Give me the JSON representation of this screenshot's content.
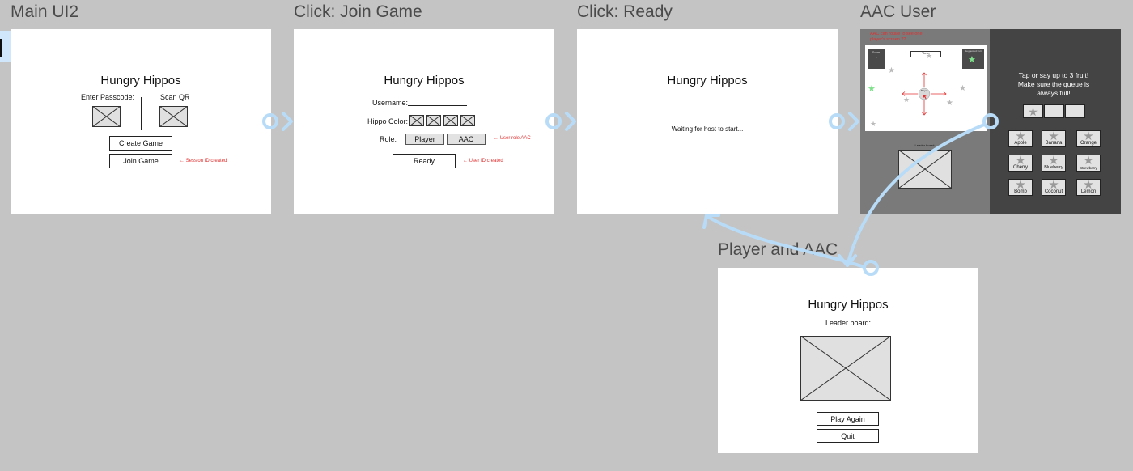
{
  "frames": {
    "main": {
      "frame_title": "Main UI2",
      "app_title": "Hungry Hippos",
      "passcode_label": "Enter Passcode:",
      "qr_label": "Scan QR",
      "create_label": "Create Game",
      "join_label": "Join Game",
      "note": "← Session ID created"
    },
    "join": {
      "frame_title": "Click: Join Game",
      "app_title": "Hungry Hippos",
      "username_label": "Username:",
      "color_label": "Hippo Color:",
      "role_label": "Role:",
      "player_label": "Player",
      "aac_label": "AAC",
      "role_note": "← User role AAC",
      "ready_label": "Ready",
      "ready_note": "← User ID created"
    },
    "ready": {
      "frame_title": "Click: Ready",
      "app_title": "Hungry Hippos",
      "status": "Waiting for host to start..."
    },
    "aac": {
      "frame_title": "AAC User",
      "rotate_note": "AAC can rotate to see one player's screen ??",
      "score_label": "Score",
      "score_value": "7",
      "timer_label": "Timer",
      "suggested_label": "Suggested fruit",
      "player_label": "Player",
      "leaderboard_label": "Leader board:",
      "instructions": "Tap or say up to 3 fruit! Make sure the queue is always full!",
      "fruits": [
        "Apple",
        "Banana",
        "Orange",
        "Cherry",
        "Blueberry",
        "Strewberry",
        "Bomb",
        "Coconut",
        "Lemon"
      ],
      "colors": {
        "panel_dark": "#444444",
        "panel_mid": "#777777",
        "green_star": "#7ee08a"
      }
    },
    "end": {
      "frame_title": "Player and AAC",
      "app_title": "Hungry Hippos",
      "leaderboard_label": "Leader board:",
      "play_again_label": "Play Again",
      "quit_label": "Quit"
    }
  },
  "colors": {
    "canvas": "#c4c4c4",
    "connector": "#b8dcf8",
    "note_red": "#e03030"
  }
}
